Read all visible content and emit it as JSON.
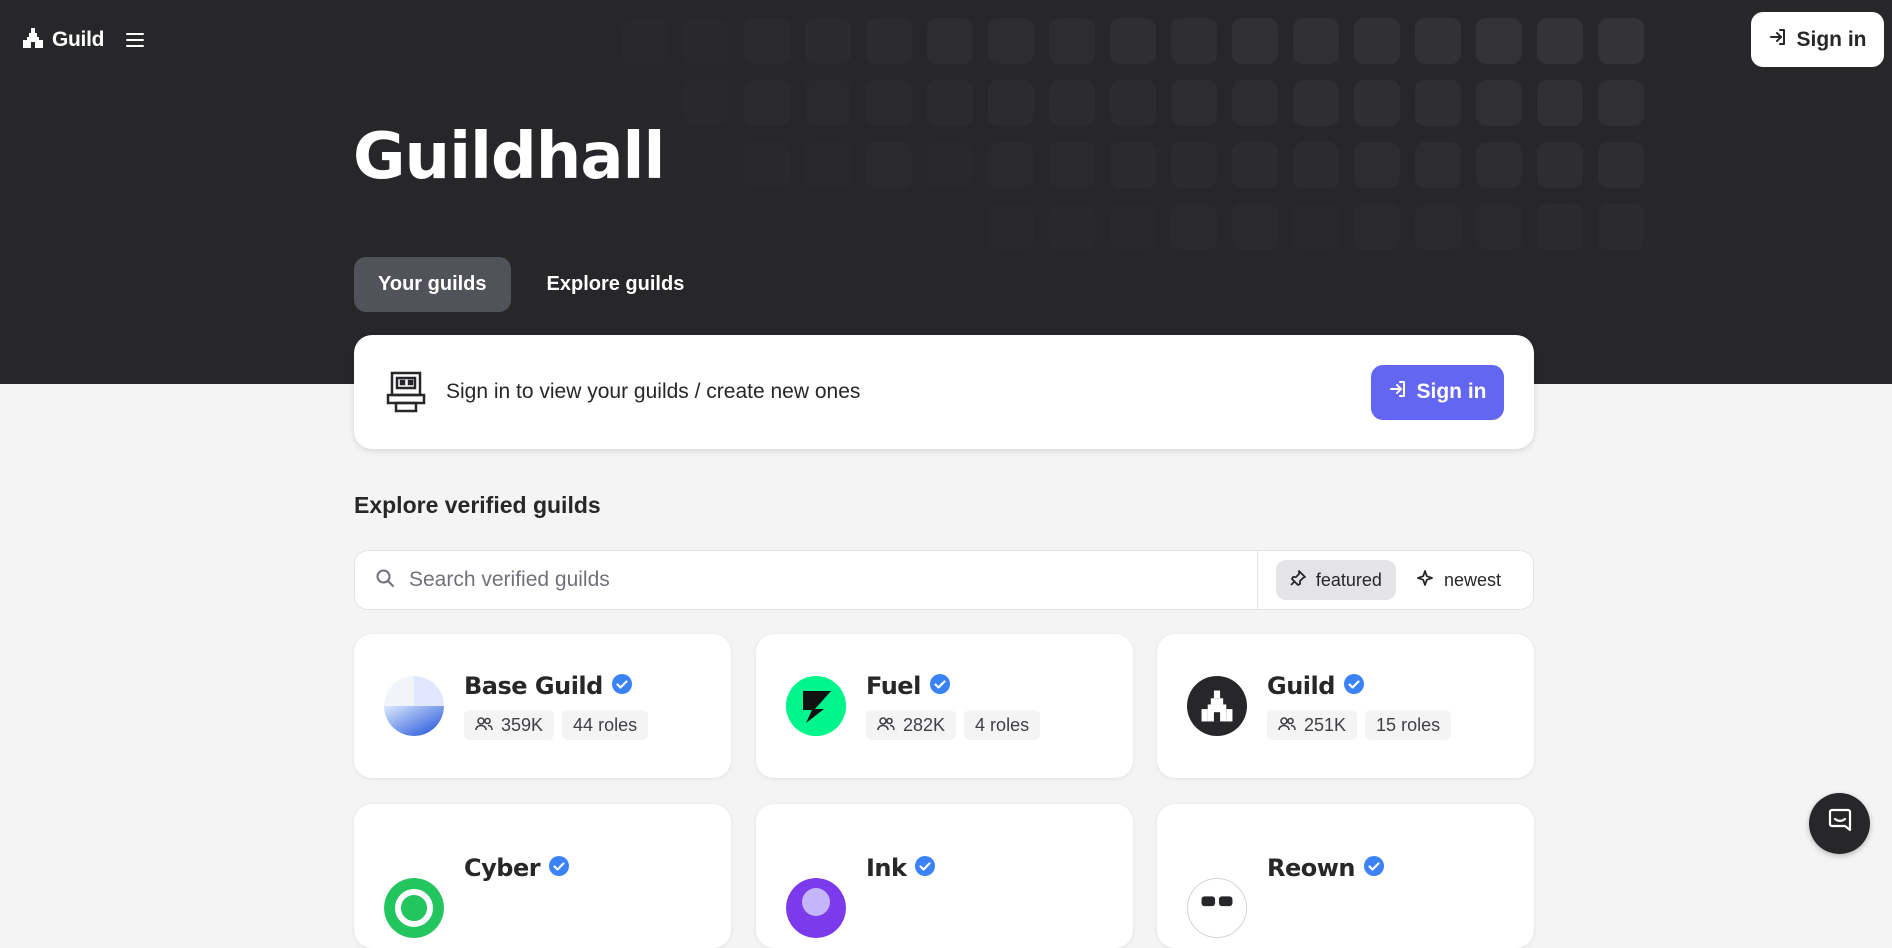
{
  "header": {
    "logo_text": "Guild",
    "signin_label": "Sign in"
  },
  "page": {
    "title": "Guildhall"
  },
  "tabs": [
    {
      "label": "Your guilds",
      "active": true
    },
    {
      "label": "Explore guilds",
      "active": false
    }
  ],
  "signin_card": {
    "message": "Sign in to view your guilds / create new ones",
    "button_label": "Sign in"
  },
  "explore": {
    "section_title": "Explore verified guilds",
    "search_placeholder": "Search verified guilds",
    "sort_options": [
      {
        "label": "featured",
        "icon": "pin-icon",
        "active": true
      },
      {
        "label": "newest",
        "icon": "sparkle-icon",
        "active": false
      }
    ]
  },
  "guilds": [
    {
      "name": "Base Guild",
      "members": "359K",
      "roles": "44 roles",
      "avatar": "base-logo"
    },
    {
      "name": "Fuel",
      "members": "282K",
      "roles": "4 roles",
      "avatar": "fuel-logo"
    },
    {
      "name": "Guild",
      "members": "251K",
      "roles": "15 roles",
      "avatar": "guild-logo"
    },
    {
      "name": "Cyber",
      "avatar": "cyber-logo"
    },
    {
      "name": "Ink",
      "avatar": "ink-logo"
    },
    {
      "name": "Reown",
      "avatar": "reown-logo"
    }
  ],
  "colors": {
    "hero_bg": "#27272a",
    "accent": "#6366f1",
    "verified": "#3b82f6",
    "page_bg": "#f4f4f5"
  }
}
